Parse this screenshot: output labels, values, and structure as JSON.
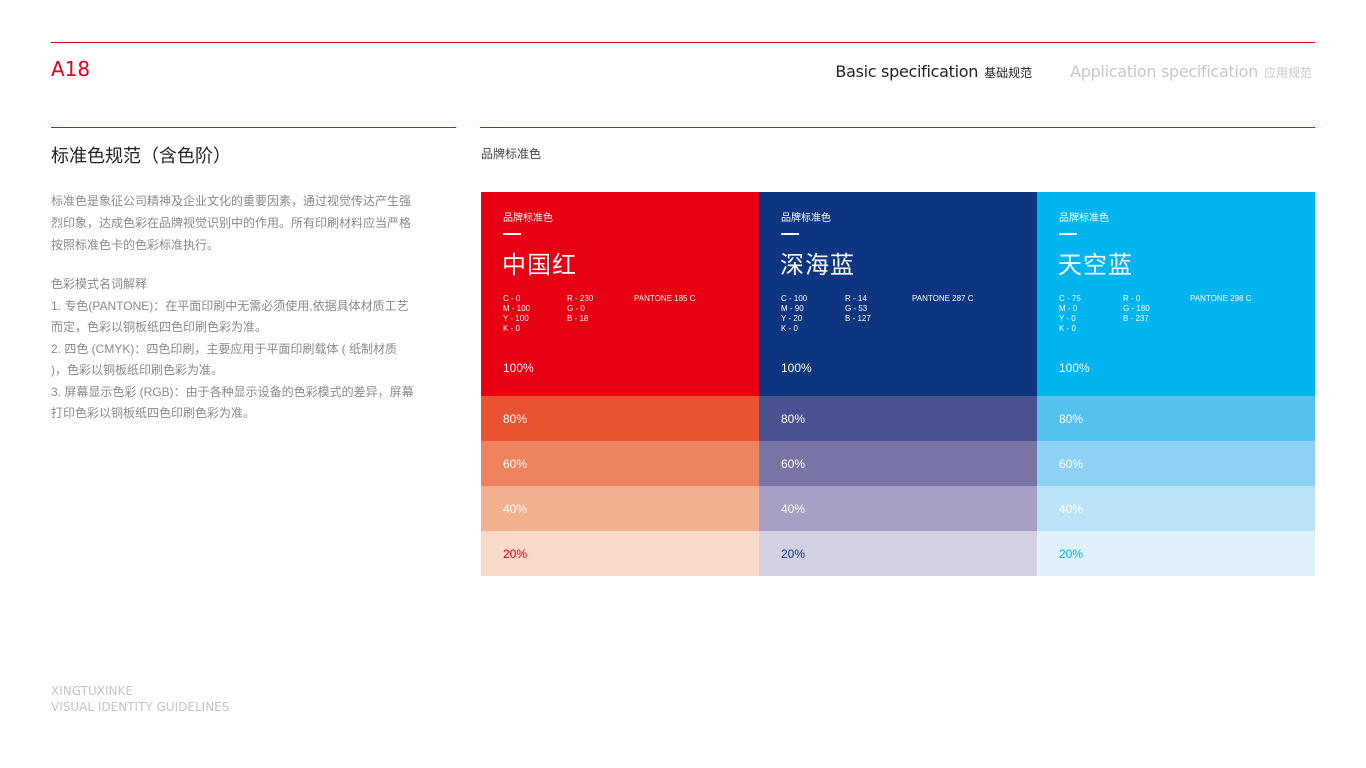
{
  "header": {
    "page_code": "A18",
    "nav": [
      {
        "en": "Basic specification",
        "cn": "基础规范",
        "state": "active"
      },
      {
        "en": "Application specification",
        "cn": "应用规范",
        "state": "inactive"
      }
    ]
  },
  "left": {
    "title": "标准色规范（含色阶）",
    "intro": "标准色是象征公司精神及企业文化的重要因素，通过视觉传达产生强烈印象，达成色彩在品牌视觉识别中的作用。所有印刷材料应当严格按照标准色卡的色彩标准执行。",
    "modes_title": "色彩模式名词解释",
    "modes": [
      "1. 专色(PANTONE)：在平面印刷中无需必须使用,依据具体材质工艺而定，色彩以铜板纸四色印刷色彩为准。",
      "2. 四色 (CMYK)：四色印刷，主要应用于平面印刷载体 ( 纸制材质 )，色彩以铜板纸印刷色彩为准。",
      "3. 屏幕显示色彩 (RGB)：由于各种显示设备的色彩模式的差异，屏幕打印色彩以铜板纸四色印刷色彩为准。"
    ]
  },
  "palette": {
    "label": "品牌标准色",
    "colors": [
      {
        "tag": "品牌标准色",
        "name": "中国红",
        "cmyk": [
          "C - 0",
          "M - 100",
          "Y - 100",
          "K - 0"
        ],
        "rgb": [
          "R - 230",
          "G - 0",
          "B - 18"
        ],
        "pantone": "PANTONE 185 C",
        "hex": "#e60012",
        "tints": [
          {
            "label": "100%",
            "bg": "#e60012",
            "fg": "#ffffff"
          },
          {
            "label": "80%",
            "bg": "#e85432",
            "fg": "#ffffff"
          },
          {
            "label": "60%",
            "bg": "#ee845f",
            "fg": "#ffffff"
          },
          {
            "label": "40%",
            "bg": "#f3b08f",
            "fg": "#ffffff"
          },
          {
            "label": "20%",
            "bg": "#f9d9c8",
            "fg": "#e60012"
          }
        ]
      },
      {
        "tag": "品牌标准色",
        "name": "深海蓝",
        "cmyk": [
          "C - 100",
          "M - 90",
          "Y - 20",
          "K - 0"
        ],
        "rgb": [
          "R - 14",
          "G - 53",
          "B - 127"
        ],
        "pantone": "PANTONE 287 C",
        "hex": "#0e357f",
        "tints": [
          {
            "label": "100%",
            "bg": "#0e357f",
            "fg": "#ffffff"
          },
          {
            "label": "80%",
            "bg": "#4a5190",
            "fg": "#ffffff"
          },
          {
            "label": "60%",
            "bg": "#7874a6",
            "fg": "#ffffff"
          },
          {
            "label": "40%",
            "bg": "#a7a0c4",
            "fg": "#ffffff"
          },
          {
            "label": "20%",
            "bg": "#d4d0e3",
            "fg": "#0e357f"
          }
        ]
      },
      {
        "tag": "品牌标准色",
        "name": "天空蓝",
        "cmyk": [
          "C - 75",
          "M - 0",
          "Y - 0",
          "K - 0"
        ],
        "rgb": [
          "R - 0",
          "G - 180",
          "B - 237"
        ],
        "pantone": "PANTONE 298 C",
        "hex": "#00b4ed",
        "tints": [
          {
            "label": "100%",
            "bg": "#00b4ed",
            "fg": "#ffffff"
          },
          {
            "label": "80%",
            "bg": "#55c1ef",
            "fg": "#ffffff"
          },
          {
            "label": "60%",
            "bg": "#8dd2f4",
            "fg": "#ffffff"
          },
          {
            "label": "40%",
            "bg": "#bbe3f8",
            "fg": "#ffffff"
          },
          {
            "label": "20%",
            "bg": "#dff1fb",
            "fg": "#00b4ed"
          }
        ]
      }
    ]
  },
  "footer": {
    "line1": "XINGTUXINKE",
    "line2": "VISUAL IDENTITY GUIDELINES"
  }
}
